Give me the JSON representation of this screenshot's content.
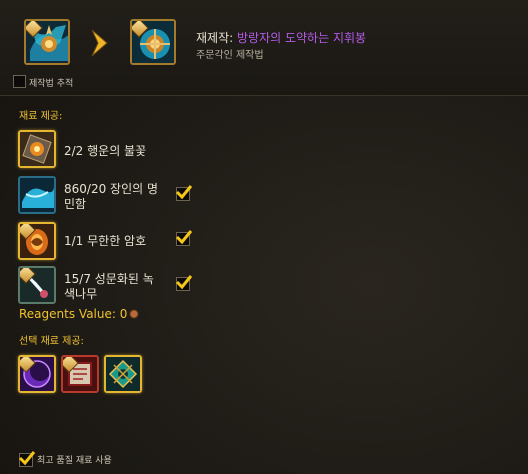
{
  "header": {
    "title_prefix": "재제작:",
    "title_item": "방랑자의 도약하는 지휘봉",
    "subtitle": "주문각인 제작법",
    "track_label": "제작법 추적"
  },
  "reagents": {
    "section_label": "재료 제공:",
    "items": [
      {
        "text": "2/2 행운의 불꽃",
        "checked": false
      },
      {
        "text_line1": "860/20 장인의 명",
        "text_line2": "민함",
        "checked": true
      },
      {
        "text": "1/1 무한한 암호",
        "checked": true
      },
      {
        "text_line1": "15/7 성문화된 녹",
        "text_line2": "색나무",
        "checked": true
      }
    ],
    "value_label": "Reagents Value: 0"
  },
  "optional": {
    "section_label": "선택 재료 제공:"
  },
  "footer": {
    "best_quality_label": "최고 품질 재료 사용",
    "checked": true
  },
  "colors": {
    "gold_label": "#f0c12e",
    "epic_purple": "#b45be8",
    "check_yellow": "#f5c518"
  },
  "icons": [
    "rune-crafting-icon",
    "staff-result-icon",
    "awakened-spark-icon",
    "artisans-acuity-icon",
    "infinite-cipher-icon",
    "codified-greenwood-icon",
    "crescent-embellishment-icon",
    "scroll-missive-icon",
    "teal-rune-icon"
  ]
}
